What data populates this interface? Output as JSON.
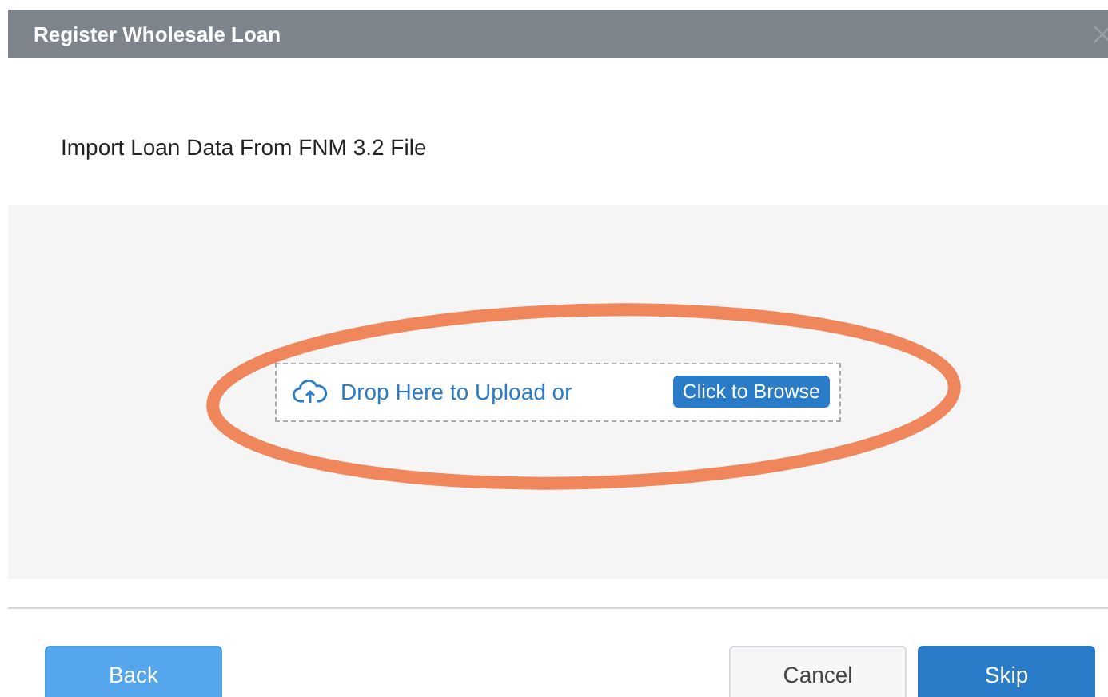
{
  "window": {
    "title": "Register Wholesale Loan"
  },
  "heading": "Import Loan Data From FNM 3.2 File",
  "dropzone": {
    "text": "Drop Here to Upload or",
    "browse_button": "Click to Browse",
    "highlighted": true
  },
  "buttons": [
    {
      "label": "Back",
      "kind": "secondary"
    },
    {
      "label": "Cancel",
      "kind": "plain"
    },
    {
      "label": "Skip",
      "kind": "primary"
    }
  ]
}
